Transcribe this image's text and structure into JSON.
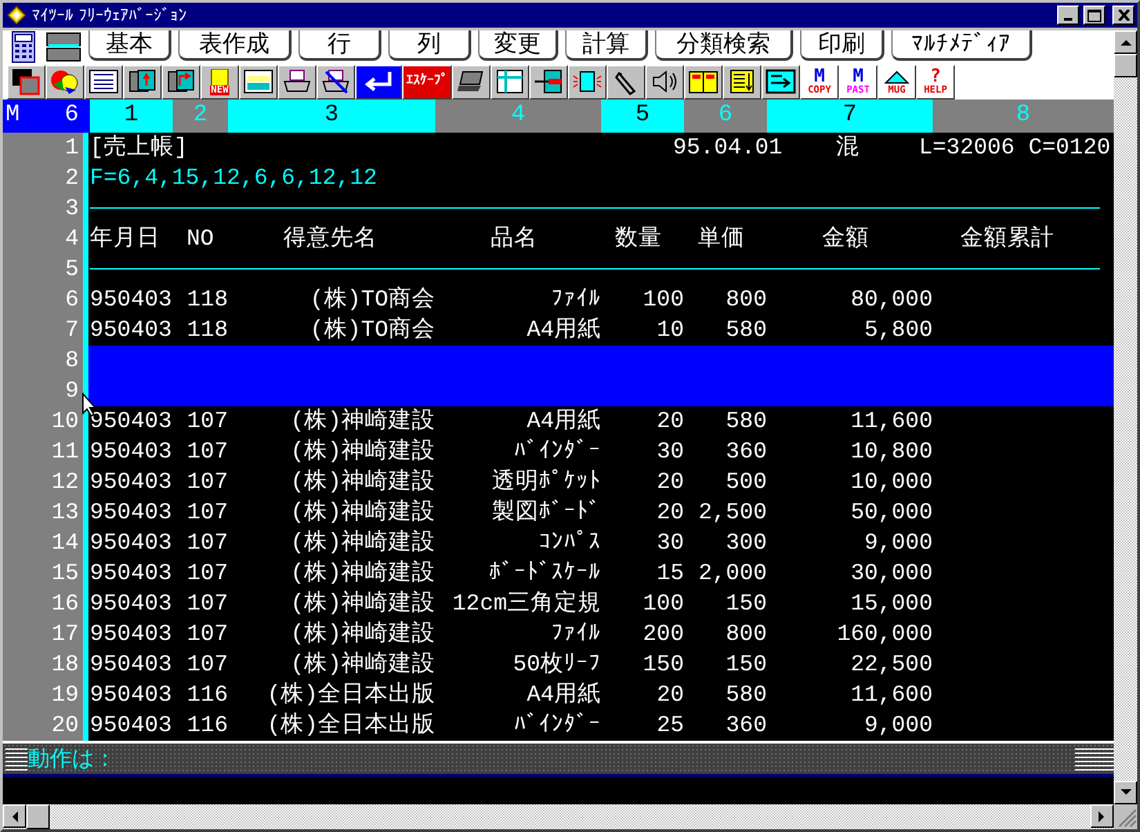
{
  "window": {
    "title": "ﾏｲﾂｰﾙ ﾌﾘｰｳｪｱﾊﾞｰｼﾞｮﾝ"
  },
  "menu_tabs": [
    {
      "label": "基本"
    },
    {
      "label": "表作成"
    },
    {
      "label": "行"
    },
    {
      "label": "列"
    },
    {
      "label": "変更"
    },
    {
      "label": "計算"
    },
    {
      "label": "分類検索"
    },
    {
      "label": "印刷"
    },
    {
      "label": "ﾏﾙﾁﾒﾃﾞｨｱ"
    }
  ],
  "toolbar": [
    {
      "kind": "window"
    },
    {
      "kind": "chart"
    },
    {
      "kind": "title"
    },
    {
      "kind": "save"
    },
    {
      "kind": "load"
    },
    {
      "kind": "new",
      "text": "NEW"
    },
    {
      "kind": "card"
    },
    {
      "kind": "print"
    },
    {
      "kind": "noprint"
    },
    {
      "kind": "enter"
    },
    {
      "kind": "escape",
      "text": "ｴｽｹｰﾌﾟ"
    },
    {
      "kind": "laptop"
    },
    {
      "kind": "table"
    },
    {
      "kind": "arrow"
    },
    {
      "kind": "page"
    },
    {
      "kind": "clip"
    },
    {
      "kind": "speaker"
    },
    {
      "kind": "book"
    },
    {
      "kind": "list"
    },
    {
      "kind": "panel"
    },
    {
      "kind": "mcopy",
      "letter": "M",
      "text": "COPY"
    },
    {
      "kind": "mpaste",
      "letter": "M",
      "text": "PAST"
    },
    {
      "kind": "mug",
      "text": "MUG"
    },
    {
      "kind": "help",
      "letter": "?",
      "text": "HELP"
    }
  ],
  "column_header": {
    "mode": "M",
    "count": "6",
    "columns": [
      "1",
      "2",
      "3",
      "4",
      "5",
      "6",
      "7",
      "8"
    ]
  },
  "sheet": {
    "rows": [
      {
        "no": "1",
        "kind": "title",
        "selected": false,
        "cells": [
          "[売上帳]",
          "95.04.01",
          "混",
          "L=32006 C=0120"
        ]
      },
      {
        "no": "2",
        "kind": "format",
        "selected": false,
        "text": "F=6,4,15,12,6,6,12,12"
      },
      {
        "no": "3",
        "kind": "rule",
        "selected": false
      },
      {
        "no": "4",
        "kind": "header",
        "selected": false,
        "cells": [
          "年月日",
          "NO",
          "得意先名",
          "品名",
          "数量",
          "単価",
          "金額",
          "金額累計"
        ]
      },
      {
        "no": "5",
        "kind": "rule",
        "selected": false
      },
      {
        "no": "6",
        "kind": "data",
        "selected": false,
        "cells": [
          "950403",
          "118",
          "(株)TO商会",
          "ﾌｧｲﾙ",
          "100",
          "800",
          "80,000"
        ]
      },
      {
        "no": "7",
        "kind": "data",
        "selected": false,
        "cells": [
          "950403",
          "118",
          "(株)TO商会",
          "A4用紙",
          "10",
          "580",
          "5,800"
        ]
      },
      {
        "no": "8",
        "kind": "blank",
        "selected": true
      },
      {
        "no": "9",
        "kind": "blank",
        "selected": true
      },
      {
        "no": "10",
        "kind": "data",
        "selected": false,
        "cells": [
          "950403",
          "107",
          "(株)神崎建設",
          "A4用紙",
          "20",
          "580",
          "11,600"
        ]
      },
      {
        "no": "11",
        "kind": "data",
        "selected": false,
        "cells": [
          "950403",
          "107",
          "(株)神崎建設",
          "ﾊﾞｲﾝﾀﾞｰ",
          "30",
          "360",
          "10,800"
        ]
      },
      {
        "no": "12",
        "kind": "data",
        "selected": false,
        "cells": [
          "950403",
          "107",
          "(株)神崎建設",
          "透明ﾎﾟｹｯﾄ",
          "20",
          "500",
          "10,000"
        ]
      },
      {
        "no": "13",
        "kind": "data",
        "selected": false,
        "cells": [
          "950403",
          "107",
          "(株)神崎建設",
          "製図ﾎﾞｰﾄﾞ",
          "20",
          "2,500",
          "50,000"
        ]
      },
      {
        "no": "14",
        "kind": "data",
        "selected": false,
        "cells": [
          "950403",
          "107",
          "(株)神崎建設",
          "ｺﾝﾊﾟｽ",
          "30",
          "300",
          "9,000"
        ]
      },
      {
        "no": "15",
        "kind": "data",
        "selected": false,
        "cells": [
          "950403",
          "107",
          "(株)神崎建設",
          "ﾎﾞｰﾄﾞｽｹｰﾙ",
          "15",
          "2,000",
          "30,000"
        ]
      },
      {
        "no": "16",
        "kind": "data",
        "selected": false,
        "cells": [
          "950403",
          "107",
          "(株)神崎建設",
          "12cm三角定規",
          "100",
          "150",
          "15,000"
        ]
      },
      {
        "no": "17",
        "kind": "data",
        "selected": false,
        "cells": [
          "950403",
          "107",
          "(株)神崎建設",
          "ﾌｧｲﾙ",
          "200",
          "800",
          "160,000"
        ]
      },
      {
        "no": "18",
        "kind": "data",
        "selected": false,
        "cells": [
          "950403",
          "107",
          "(株)神崎建設",
          "50枚ﾘｰﾌ",
          "150",
          "150",
          "22,500"
        ]
      },
      {
        "no": "19",
        "kind": "data",
        "selected": false,
        "cells": [
          "950403",
          "116",
          "(株)全日本出版",
          "A4用紙",
          "20",
          "580",
          "11,600"
        ]
      },
      {
        "no": "20",
        "kind": "data",
        "selected": false,
        "cells": [
          "950403",
          "116",
          "(株)全日本出版",
          "ﾊﾞｲﾝﾀﾞｰ",
          "25",
          "360",
          "9,000"
        ]
      }
    ]
  },
  "status": {
    "prompt": "動作は："
  }
}
